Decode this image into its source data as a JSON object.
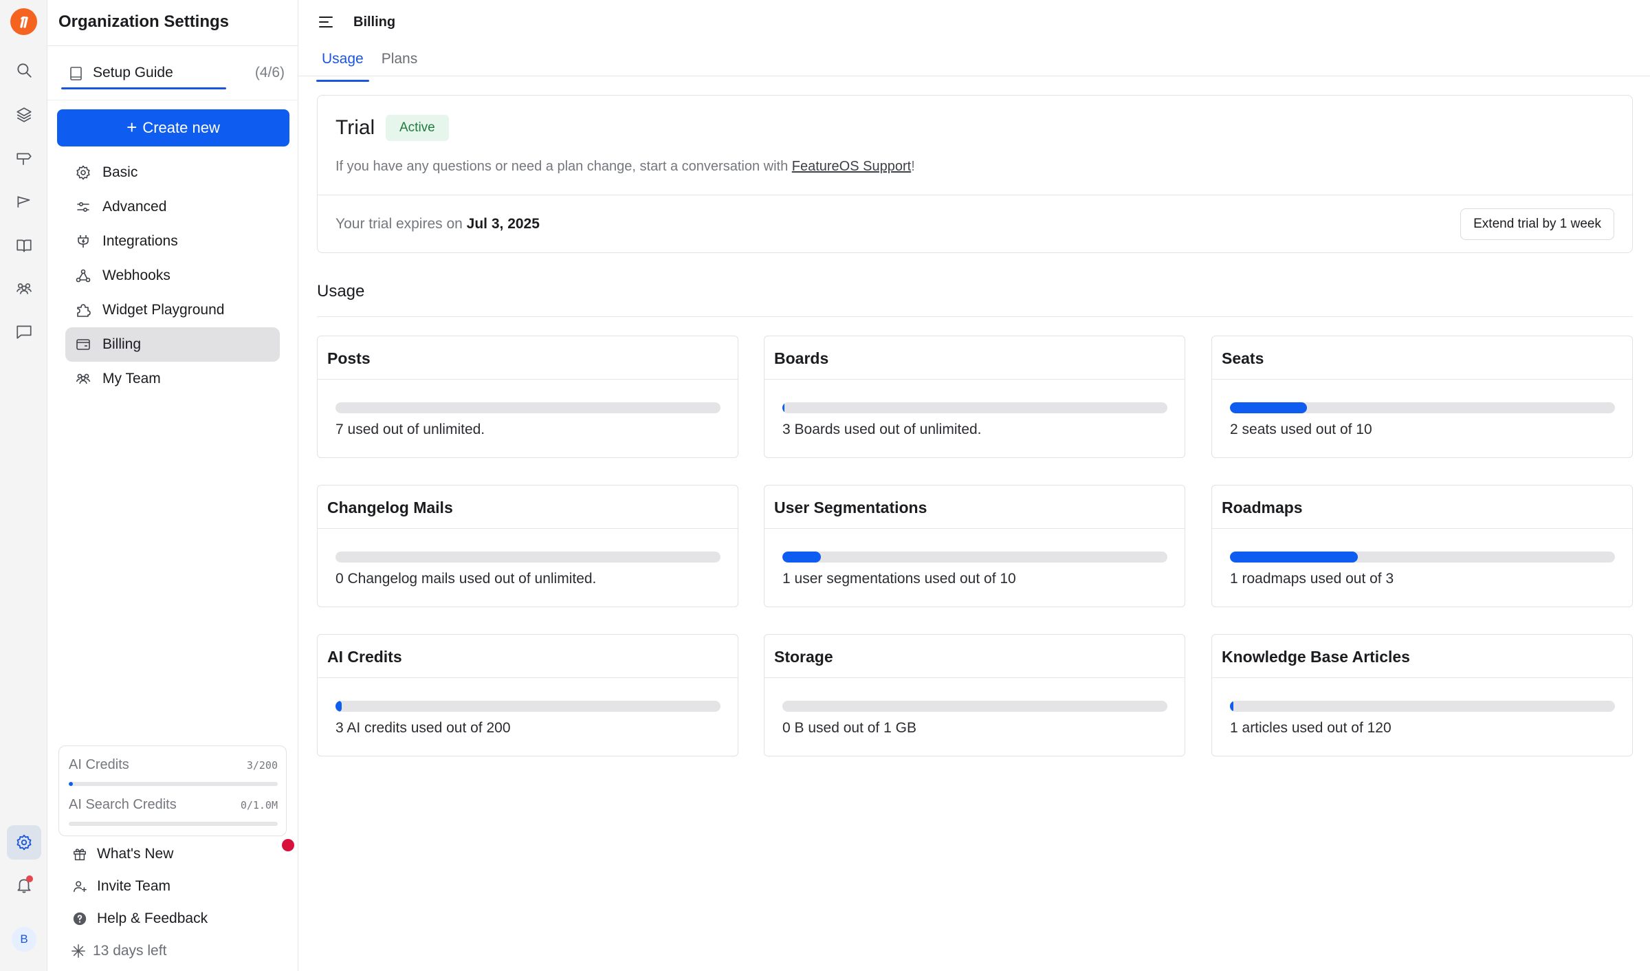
{
  "rail": {
    "icons": [
      "logo-icon",
      "search-icon",
      "layers-icon",
      "signpost-icon",
      "megaphone-icon",
      "book-open-icon",
      "team-icon",
      "message-icon",
      "settings-icon",
      "bell-icon"
    ],
    "avatar_initial": "B"
  },
  "sidebar": {
    "title": "Organization Settings",
    "setup_guide": {
      "label": "Setup Guide",
      "count": "(4/6)"
    },
    "create_new_label": "Create new",
    "items": [
      {
        "label": "Basic",
        "icon": "gear-icon"
      },
      {
        "label": "Advanced",
        "icon": "sliders-icon"
      },
      {
        "label": "Integrations",
        "icon": "plug-icon"
      },
      {
        "label": "Webhooks",
        "icon": "webhook-icon"
      },
      {
        "label": "Widget Playground",
        "icon": "puzzle-icon"
      },
      {
        "label": "Billing",
        "icon": "wallet-icon",
        "active": true
      },
      {
        "label": "My Team",
        "icon": "team-icon"
      }
    ],
    "credits": [
      {
        "name": "AI Credits",
        "value": "3/200",
        "fraction": 0.015
      },
      {
        "name": "AI Search Credits",
        "value": "0/1.0M",
        "fraction": 0
      }
    ],
    "bottom": {
      "whats_new": "What's New",
      "invite_team": "Invite Team",
      "help_feedback": "Help & Feedback",
      "days_left": "13 days left"
    }
  },
  "header": {
    "breadcrumb": "Billing",
    "tabs": [
      {
        "label": "Usage",
        "active": true
      },
      {
        "label": "Plans",
        "active": false
      }
    ]
  },
  "trial": {
    "title": "Trial",
    "badge": "Active",
    "question_prefix": "If you have any questions or need a plan change, start a conversation with ",
    "support_link": "FeatureOS Support",
    "question_suffix": "!",
    "expires_prefix": "Your trial expires on ",
    "expires_date": "Jul 3, 2025",
    "extend_button": "Extend trial by 1 week"
  },
  "usage": {
    "title": "Usage",
    "cards": [
      {
        "title": "Posts",
        "text": "7 used out of unlimited.",
        "fraction": 0
      },
      {
        "title": "Boards",
        "text": "3 Boards used out of unlimited.",
        "fraction": 0.003
      },
      {
        "title": "Seats",
        "text": "2 seats used out of 10",
        "fraction": 0.2
      },
      {
        "title": "Changelog Mails",
        "text": "0 Changelog mails used out of unlimited.",
        "fraction": 0
      },
      {
        "title": "User Segmentations",
        "text": "1 user segmentations used out of 10",
        "fraction": 0.1
      },
      {
        "title": "Roadmaps",
        "text": "1 roadmaps used out of 3",
        "fraction": 0.333
      },
      {
        "title": "AI Credits",
        "text": "3 AI credits used out of 200",
        "fraction": 0.015
      },
      {
        "title": "Storage",
        "text": "0 B used out of 1 GB",
        "fraction": 0
      },
      {
        "title": "Knowledge Base Articles",
        "text": "1 articles used out of 120",
        "fraction": 0.008
      }
    ]
  },
  "colors": {
    "accent": "#0e5cf0",
    "logo": "#f4631f",
    "badge_bg": "#e7f6ec",
    "badge_text": "#1f7a3e",
    "notification_dot": "#d8103c"
  }
}
